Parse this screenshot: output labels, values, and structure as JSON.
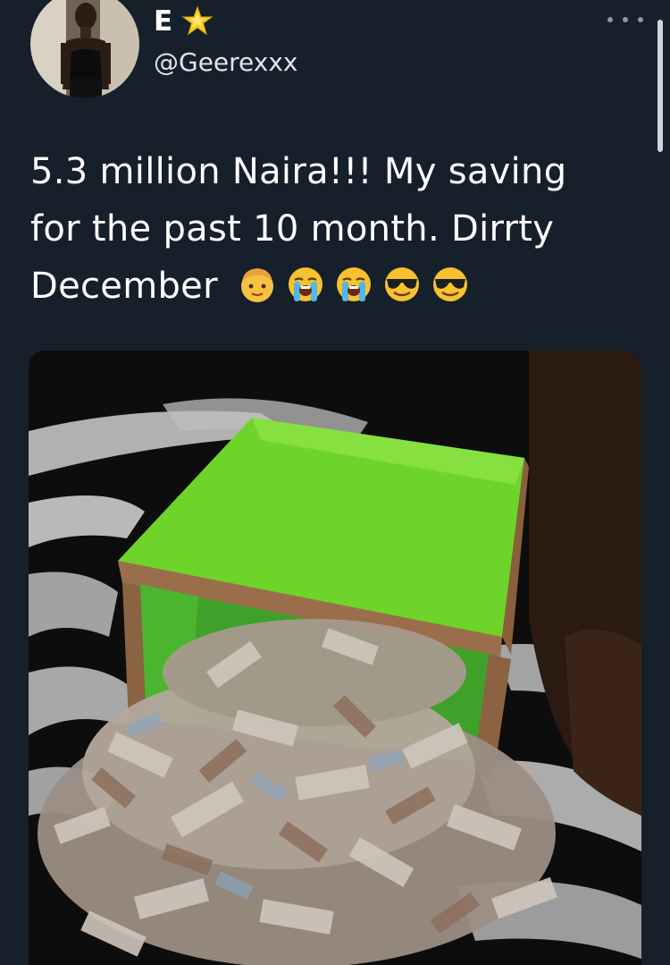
{
  "tweet": {
    "author": {
      "display_name": "E",
      "badge_icon": "glowing-star-icon",
      "handle": "@Geerexxx",
      "avatar_icon": "avatar-photo"
    },
    "more_icon": "more-options-icon",
    "text": "5.3 million Naira!!! My saving for the past 10 month. Dirrty December",
    "emojis": [
      "boy-face-emoji",
      "loudly-crying-face-emoji",
      "loudly-crying-face-emoji",
      "smiling-face-with-sunglasses-emoji",
      "smiling-face-with-sunglasses-emoji"
    ],
    "media": {
      "description_icon": "photo-money-box"
    }
  },
  "colors": {
    "background": "#15202b",
    "text_primary": "#ffffff",
    "text_secondary": "#dfe4ea",
    "box_green": "#6fd42a"
  }
}
